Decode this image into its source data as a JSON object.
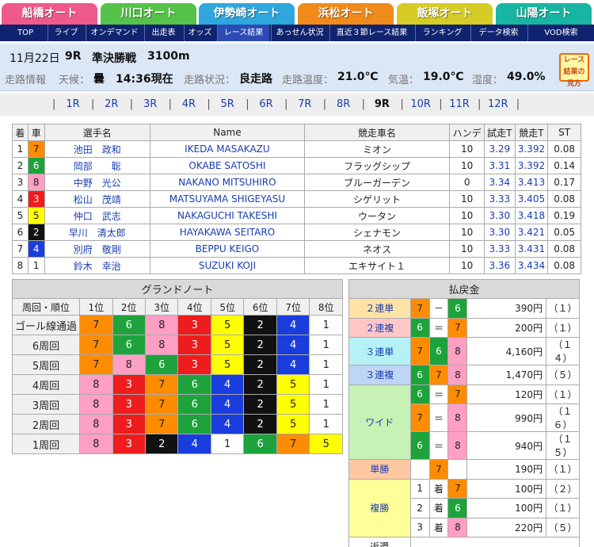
{
  "venues": [
    {
      "label": "船橋オート",
      "color": "#ef5a8a"
    },
    {
      "label": "川口オート",
      "color": "#55c24a"
    },
    {
      "label": "伊勢崎オート",
      "color": "#2ea7dd"
    },
    {
      "label": "浜松オート",
      "color": "#f08a1a"
    },
    {
      "label": "飯塚オート",
      "color": "#d6cc25"
    },
    {
      "label": "山陽オート",
      "color": "#18b5a2"
    }
  ],
  "nav": [
    "TOP",
    "ライブ",
    "オンデマンド",
    "出走表",
    "オッズ",
    "レース結果",
    "あっせん状況",
    "直近３節レース結果",
    "ランキング",
    "データ検索",
    "VOD検索"
  ],
  "race": {
    "date": "11月22日",
    "race_no": "9R",
    "race_name": "準決勝戦",
    "distance": "3100m",
    "track_info_label": "走路情報",
    "weather_label": "天候：",
    "weather": "曇",
    "time": "14:36現在",
    "track_cond_label": "走路状況：",
    "track_cond": "良走路",
    "track_temp_label": "走路温度：",
    "track_temp": "21.0℃",
    "air_temp_label": "気温：",
    "air_temp": "19.0℃",
    "humidity_label": "湿度：",
    "humidity": "49.0%",
    "badge": "レース結果の見方"
  },
  "races": [
    "1R",
    "2R",
    "3R",
    "4R",
    "5R",
    "6R",
    "7R",
    "8R",
    "9R",
    "10R",
    "11R",
    "12R"
  ],
  "results_headers": [
    "着",
    "車",
    "選手名",
    "Name",
    "競走車名",
    "ハンデ",
    "試走T",
    "競走T",
    "ST"
  ],
  "results": [
    {
      "pos": "1",
      "car": "7",
      "name": "池田　政和",
      "romaji": "IKEDA MASAKAZU",
      "bike": "ミオン",
      "handicap": "10",
      "trial": "3.29",
      "race_t": "3.392",
      "st": "0.08"
    },
    {
      "pos": "2",
      "car": "6",
      "name": "岡部　　聡",
      "romaji": "OKABE SATOSHI",
      "bike": "フラッグシップ",
      "handicap": "10",
      "trial": "3.31",
      "race_t": "3.392",
      "st": "0.14"
    },
    {
      "pos": "3",
      "car": "8",
      "name": "中野　光公",
      "romaji": "NAKANO MITSUHIRO",
      "bike": "ブルーガーデン",
      "handicap": "0",
      "trial": "3.34",
      "race_t": "3.413",
      "st": "0.17"
    },
    {
      "pos": "4",
      "car": "3",
      "name": "松山　茂靖",
      "romaji": "MATSUYAMA SHIGEYASU",
      "bike": "シゲリット",
      "handicap": "10",
      "trial": "3.33",
      "race_t": "3.405",
      "st": "0.08"
    },
    {
      "pos": "5",
      "car": "5",
      "name": "仲口　武志",
      "romaji": "NAKAGUCHI TAKESHI",
      "bike": "ウータン",
      "handicap": "10",
      "trial": "3.30",
      "race_t": "3.418",
      "st": "0.19"
    },
    {
      "pos": "6",
      "car": "2",
      "name": "早川　清太郎",
      "romaji": "HAYAKAWA SEITARO",
      "bike": "シェナモン",
      "handicap": "10",
      "trial": "3.30",
      "race_t": "3.421",
      "st": "0.05"
    },
    {
      "pos": "7",
      "car": "4",
      "name": "別府　敬剛",
      "romaji": "BEPPU KEIGO",
      "bike": "ネオス",
      "handicap": "10",
      "trial": "3.33",
      "race_t": "3.431",
      "st": "0.08"
    },
    {
      "pos": "8",
      "car": "1",
      "name": "鈴木　幸治",
      "romaji": "SUZUKI KOJI",
      "bike": "エキサイト１",
      "handicap": "10",
      "trial": "3.36",
      "race_t": "3.434",
      "st": "0.08"
    }
  ],
  "car_colors": {
    "1": {
      "bg": "#ffffff",
      "fg": "#222222"
    },
    "2": {
      "bg": "#111111",
      "fg": "#ffffff"
    },
    "3": {
      "bg": "#ee1c1c",
      "fg": "#ffffff"
    },
    "4": {
      "bg": "#1a3ddd",
      "fg": "#ffffff"
    },
    "5": {
      "bg": "#ffff00",
      "fg": "#222222"
    },
    "6": {
      "bg": "#1ea33c",
      "fg": "#ffffff"
    },
    "7": {
      "bg": "#ff8c00",
      "fg": "#222222"
    },
    "8": {
      "bg": "#ff9fc3",
      "fg": "#222222"
    }
  },
  "grand_note": {
    "title": "グランドノート",
    "header_first": "周回・順位",
    "positions": [
      "1位",
      "2位",
      "3位",
      "4位",
      "5位",
      "6位",
      "7位",
      "8位"
    ],
    "rows": [
      {
        "label": "ゴール線通過",
        "cars": [
          "7",
          "6",
          "8",
          "3",
          "5",
          "2",
          "4",
          "1"
        ]
      },
      {
        "label": "6周回",
        "cars": [
          "7",
          "6",
          "8",
          "3",
          "5",
          "2",
          "4",
          "1"
        ]
      },
      {
        "label": "5周回",
        "cars": [
          "7",
          "8",
          "6",
          "3",
          "5",
          "2",
          "4",
          "1"
        ]
      },
      {
        "label": "4周回",
        "cars": [
          "8",
          "3",
          "7",
          "6",
          "4",
          "2",
          "5",
          "1"
        ]
      },
      {
        "label": "3周回",
        "cars": [
          "8",
          "3",
          "7",
          "6",
          "4",
          "2",
          "5",
          "1"
        ]
      },
      {
        "label": "2周回",
        "cars": [
          "8",
          "3",
          "7",
          "6",
          "4",
          "2",
          "5",
          "1"
        ]
      },
      {
        "label": "1周回",
        "cars": [
          "8",
          "3",
          "2",
          "4",
          "1",
          "6",
          "7",
          "5"
        ]
      }
    ]
  },
  "payout": {
    "title": "払戻金",
    "nirentan": {
      "label": "２連単",
      "color": "#ffe3a6",
      "a": "7",
      "sym": "－",
      "b": "6",
      "yen": "390円",
      "pop": "（１）"
    },
    "nirenpuku": {
      "label": "２連複",
      "color": "#ffc6c6",
      "a": "6",
      "sym": "＝",
      "b": "7",
      "yen": "200円",
      "pop": "（１）"
    },
    "sanrentan": {
      "label": "３連単",
      "color": "#b6f2f5",
      "a": "7",
      "b": "6",
      "c": "8",
      "yen": "4,160円",
      "pop": "（１４）"
    },
    "sanrenpuku": {
      "label": "３連複",
      "color": "#bfd5f5",
      "a": "6",
      "b": "7",
      "c": "8",
      "yen": "1,470円",
      "pop": "（５）"
    },
    "wide": {
      "label": "ワイド",
      "color": "#c6f2b6",
      "rows": [
        {
          "a": "6",
          "sym": "＝",
          "b": "7",
          "yen": "120円",
          "pop": "（１）"
        },
        {
          "a": "7",
          "sym": "＝",
          "b": "8",
          "yen": "990円",
          "pop": "（１６）"
        },
        {
          "a": "6",
          "sym": "＝",
          "b": "8",
          "yen": "940円",
          "pop": "（１５）"
        }
      ]
    },
    "tansho": {
      "label": "単勝",
      "color": "#ffc8a2",
      "a": "7",
      "yen": "190円",
      "pop": "（１）"
    },
    "fukusho": {
      "label": "複勝",
      "color": "#ffff99",
      "rows": [
        {
          "place": "1",
          "chaku": "着",
          "a": "7",
          "yen": "100円",
          "pop": "（２）"
        },
        {
          "place": "2",
          "chaku": "着",
          "a": "6",
          "yen": "100円",
          "pop": "（１）"
        },
        {
          "place": "3",
          "chaku": "着",
          "a": "8",
          "yen": "220円",
          "pop": "（５）"
        }
      ]
    },
    "henkan": {
      "label": "返還"
    }
  }
}
